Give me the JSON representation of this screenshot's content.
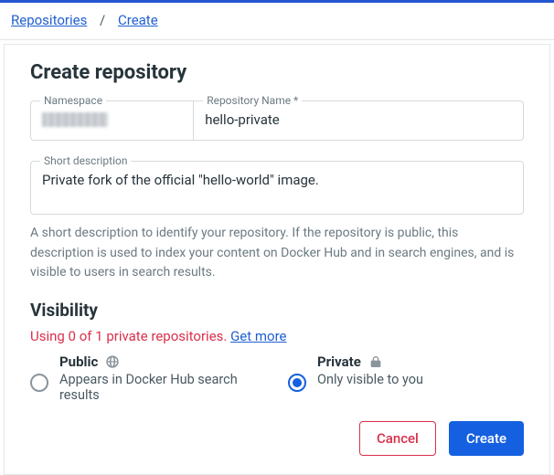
{
  "breadcrumb": {
    "root": "Repositories",
    "sep": "/",
    "current": "Create"
  },
  "title": "Create repository",
  "fields": {
    "namespace": {
      "label": "Namespace"
    },
    "repo_name": {
      "label": "Repository Name *",
      "value": "hello-private"
    },
    "short_desc": {
      "label": "Short description",
      "value": "Private fork of the official \"hello-world\" image."
    }
  },
  "short_desc_helper": "A short description to identify your repository. If the repository is public, this description is used to index your content on Docker Hub and in search engines, and is visible to users in search results.",
  "visibility": {
    "heading": "Visibility",
    "usage_text": "Using 0 of 1 private repositories. ",
    "get_more": "Get more",
    "options": {
      "public": {
        "label": "Public",
        "sub": "Appears in Docker Hub search results",
        "checked": false
      },
      "private": {
        "label": "Private",
        "sub": "Only visible to you",
        "checked": true
      }
    }
  },
  "actions": {
    "cancel": "Cancel",
    "create": "Create"
  }
}
